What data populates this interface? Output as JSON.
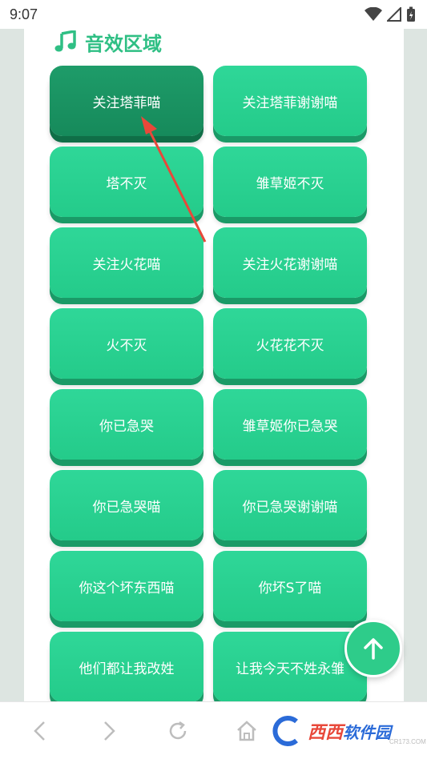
{
  "status_bar": {
    "time": "9:07"
  },
  "section": {
    "title": "音效区域",
    "icon": "music-note-icon"
  },
  "buttons": [
    "关注塔菲喵",
    "关注塔菲谢谢喵",
    "塔不灭",
    "雏草姬不灭",
    "关注火花喵",
    "关注火花谢谢喵",
    "火不灭",
    "火花花不灭",
    "你已急哭",
    "雏草姬你已急哭",
    "你已急哭喵",
    "你已急哭谢谢喵",
    "你这个坏东西喵",
    "你坏S了喵",
    "他们都让我改姓",
    "让我今天不姓永雏"
  ],
  "pressed_button_index": 0,
  "scroll_top": {
    "icon": "arrow-up-icon"
  },
  "bottom_nav": {
    "icons": [
      "back-icon",
      "forward-icon",
      "refresh-icon",
      "home-icon"
    ]
  },
  "watermark": {
    "text1": "西西",
    "text2": "软件园",
    "url": "CR173.COM"
  },
  "colors": {
    "accent": "#2fbf84",
    "button": "#24cb8a",
    "button_pressed": "#168a5b",
    "annotation_arrow": "#e8483a"
  }
}
